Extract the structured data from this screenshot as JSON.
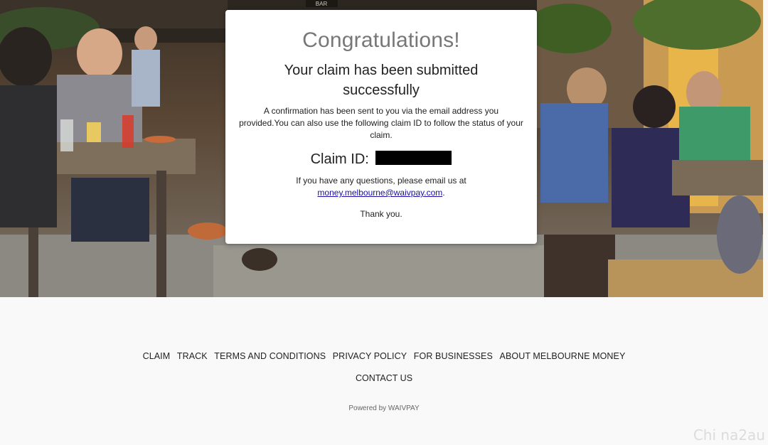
{
  "card": {
    "heading": "Congratulations!",
    "subheading": "Your claim has been submitted successfully",
    "confirmation_text": "A confirmation has been sent to you via the email address you provided.You can also use the following claim ID to follow the status of your claim.",
    "claim_label": "Claim ID:",
    "questions_prefix": "If you have any questions, please email us at",
    "email": "money.melbourne@waivpay.com",
    "questions_suffix": ".",
    "thanks": "Thank you."
  },
  "footer": {
    "links": [
      "CLAIM",
      "TRACK",
      "TERMS AND CONDITIONS",
      "PRIVACY POLICY",
      "FOR BUSINESSES",
      "ABOUT MELBOURNE MONEY"
    ],
    "contact": "CONTACT US",
    "powered_by": "Powered by WAIVPAY"
  },
  "hero": {
    "sign_text": "BAR"
  },
  "watermark": "Chi  na2au",
  "colors": {
    "heading": "#777777",
    "link": "#1a0dab",
    "card_bg": "#ffffff",
    "page_bg": "#f9f9f9"
  }
}
